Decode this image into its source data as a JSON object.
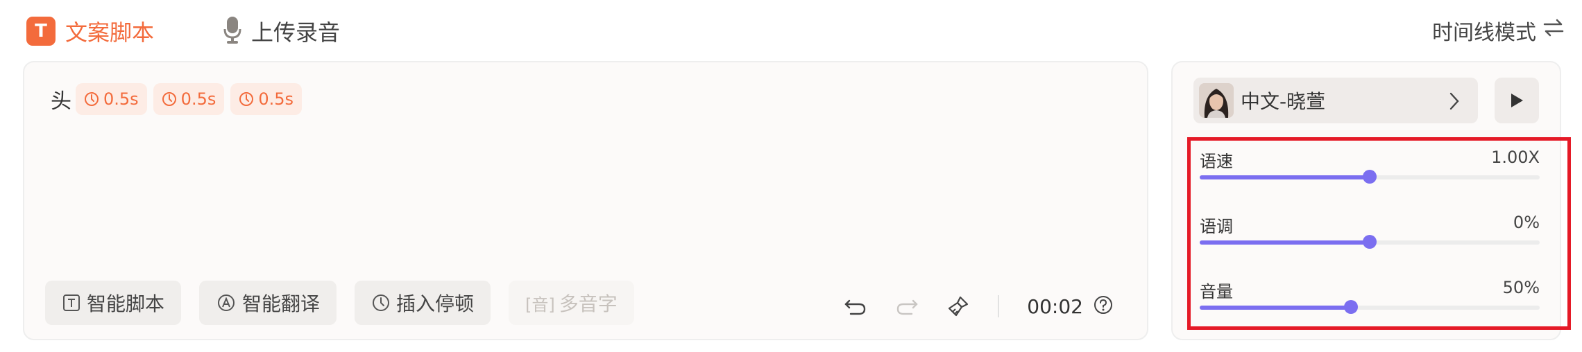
{
  "tabs": {
    "script_label": "文案脚本",
    "script_icon": "T",
    "upload_label": "上传录音",
    "timeline_label": "时间线模式"
  },
  "editor": {
    "text": "头",
    "pauses": [
      "0.5s",
      "0.5s",
      "0.5s"
    ],
    "toolbar": {
      "smart_script": "智能脚本",
      "smart_translate": "智能翻译",
      "insert_pause": "插入停顿",
      "polyphone_tag": "[音]",
      "polyphone": "多音字"
    },
    "time": "00:02"
  },
  "voice": {
    "name": "中文-晓萱"
  },
  "sliders": [
    {
      "label": "语速",
      "value": "1.00X",
      "level": 0.5
    },
    {
      "label": "语调",
      "value": "0%",
      "level": 0.5
    },
    {
      "label": "音量",
      "value": "50%",
      "level": 0.445
    }
  ],
  "colors": {
    "accent": "#f36b3c",
    "slider": "#7b6ef0",
    "highlight": "#e51a27"
  }
}
